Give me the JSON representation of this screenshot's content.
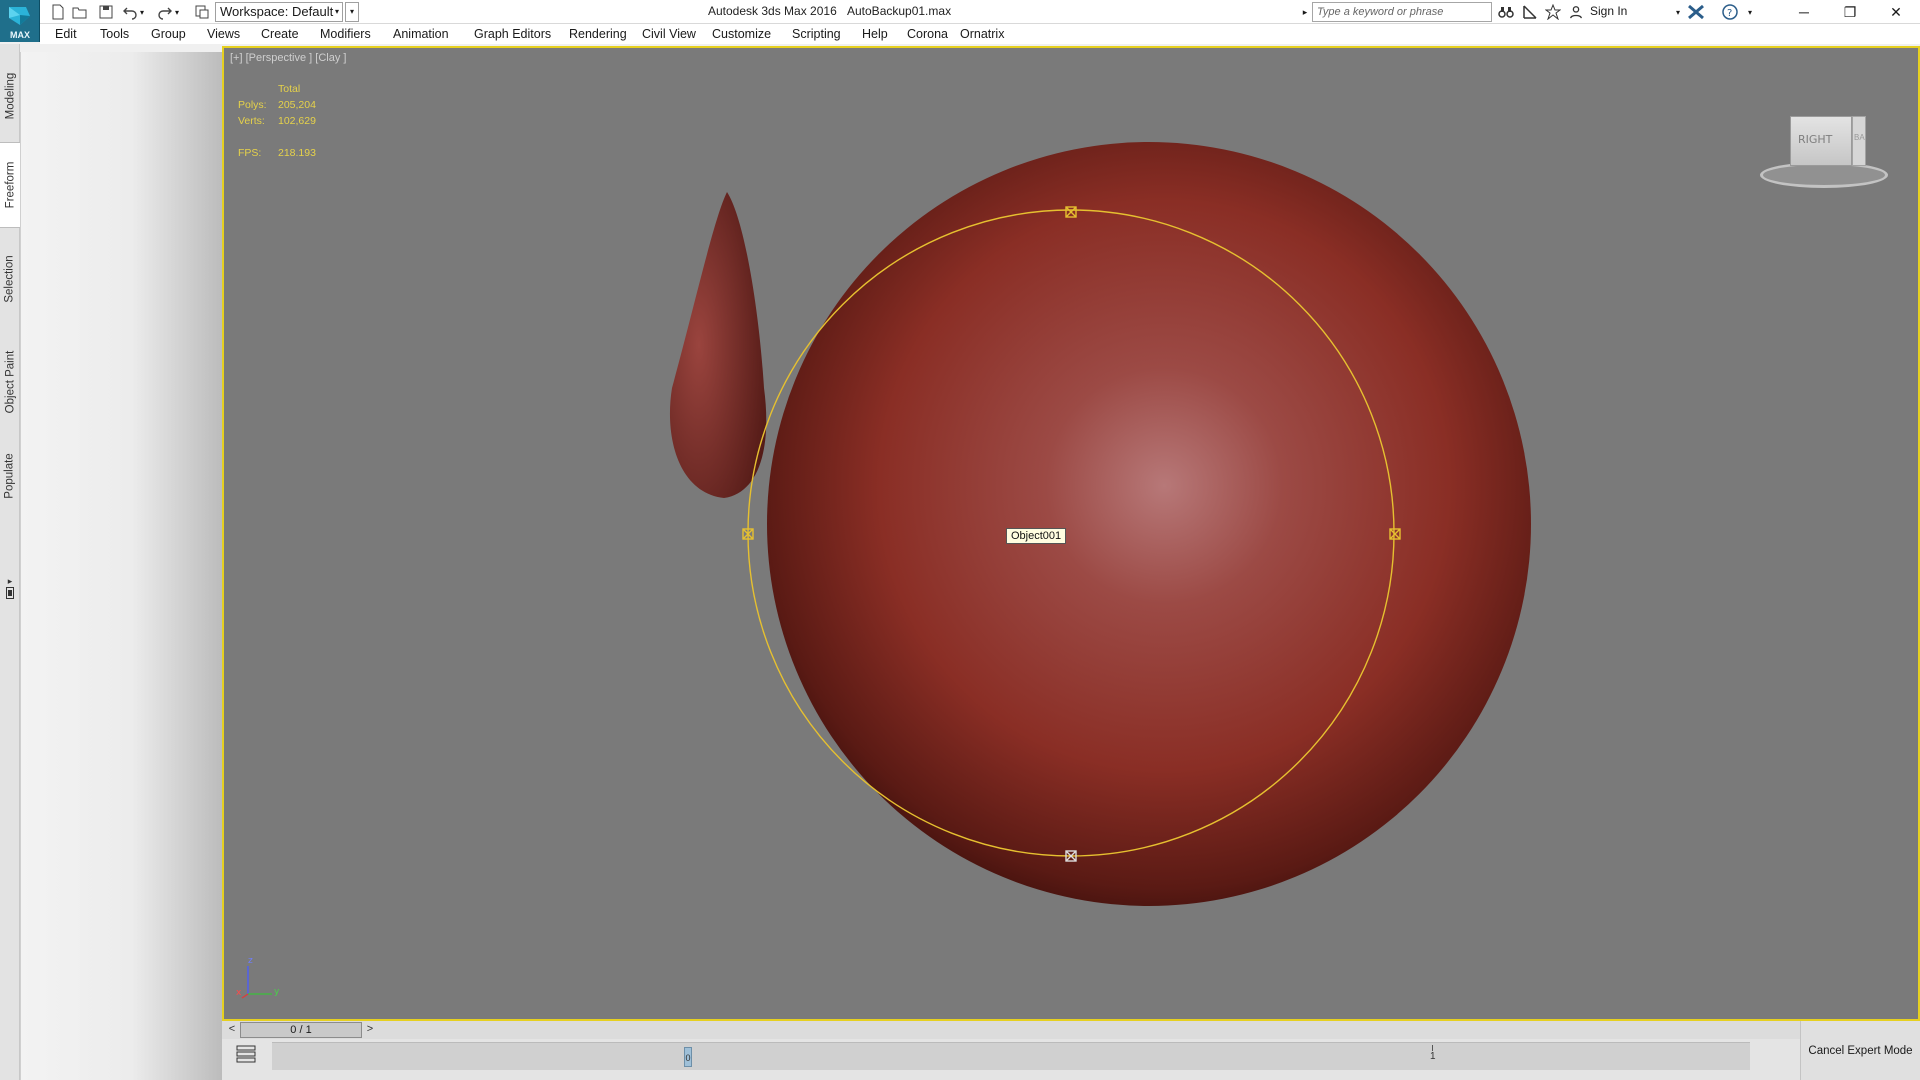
{
  "titlebar": {
    "logo_label": "MAX",
    "workspace_label": "Workspace: Default",
    "app_title": "Autodesk 3ds Max 2016",
    "file_name": "AutoBackup01.max",
    "search_placeholder": "Type a keyword or phrase",
    "sign_in": "Sign In"
  },
  "menu": [
    "Edit",
    "Tools",
    "Group",
    "Views",
    "Create",
    "Modifiers",
    "Animation",
    "Graph Editors",
    "Rendering",
    "Civil View",
    "Customize",
    "Scripting",
    "Help",
    "Corona",
    "Ornatrix"
  ],
  "ribbon_tabs": [
    "Modeling",
    "Freeform",
    "Selection",
    "Object Paint",
    "Populate"
  ],
  "ribbon_active_tab": "Freeform",
  "viewport": {
    "label": "[+] [Perspective ] [Clay ]",
    "stats": {
      "header": "Total",
      "polys_label": "Polys:",
      "polys_value": "205,204",
      "verts_label": "Verts:",
      "verts_value": "102,629",
      "fps_label": "FPS:",
      "fps_value": "218.193"
    },
    "object_tooltip": "Object001",
    "viewcube_face": "RIGHT",
    "viewcube_side": "BA",
    "axis_z": "z",
    "axis_x": "x",
    "axis_y": "y",
    "colors": {
      "border": "#e6d020",
      "background": "#7a7a7a",
      "object": "#a83a2f",
      "gizmo": "#e6c030"
    }
  },
  "timeline": {
    "prev": "<",
    "frame": "0 / 1",
    "next": ">",
    "key_label": "0",
    "end_label": "1"
  },
  "cancel_expert": "Cancel Expert Mode"
}
